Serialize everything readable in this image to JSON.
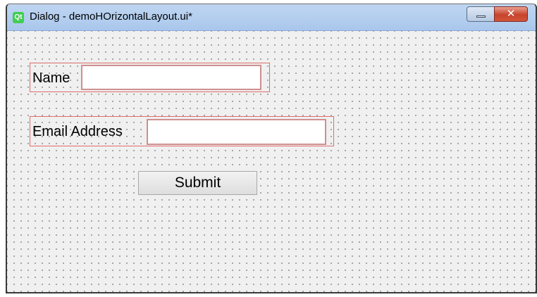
{
  "window": {
    "title": "Dialog - demoHOrizontalLayout.ui*",
    "app_icon_text": "Qt",
    "close_glyph": "✕"
  },
  "icons": {
    "app": "qt-logo-icon",
    "minimize": "minimize-icon",
    "close": "close-icon"
  },
  "form": {
    "name_label": "Name",
    "name_value": "",
    "email_label": "Email Address",
    "email_value": "",
    "submit_label": "Submit"
  },
  "colors": {
    "layout_border": "#e06b6b",
    "grid_dot": "#8d8d8d",
    "close_button": "#c7432c"
  }
}
